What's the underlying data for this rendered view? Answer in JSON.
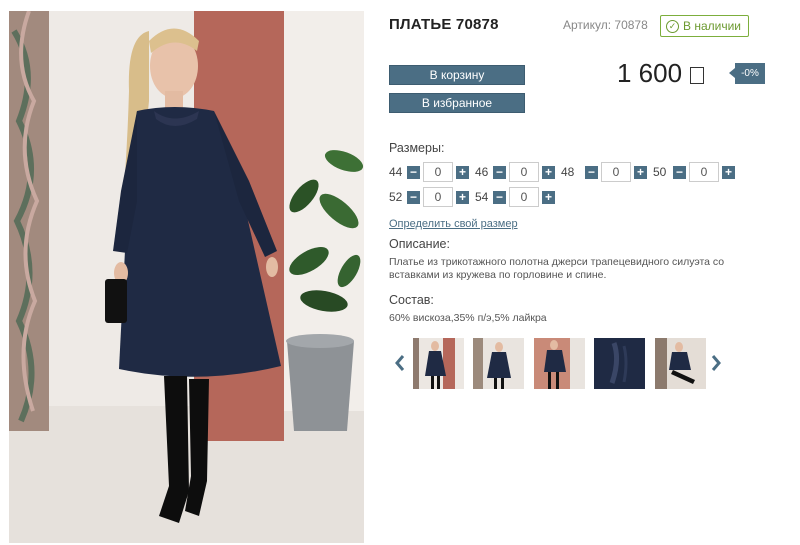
{
  "product": {
    "title": "ПЛАТЬЕ 70878",
    "sku": "Артикул: 70878",
    "stock": "В наличии",
    "add_to_cart": "В корзину",
    "add_to_favorites": "В избранное",
    "price": "1 600",
    "discount": "-0%"
  },
  "sizes": {
    "label": "Размеры:",
    "items": [
      {
        "size": "44",
        "qty": "0"
      },
      {
        "size": "46",
        "qty": "0"
      },
      {
        "size": "48",
        "qty": "0"
      },
      {
        "size": "50",
        "qty": "0"
      },
      {
        "size": "52",
        "qty": "0"
      },
      {
        "size": "54",
        "qty": "0"
      }
    ],
    "minus": "−",
    "plus": "+",
    "find_size_link": "Определить свой размер"
  },
  "description": {
    "label": "Описание:",
    "text": "Платье из трикотажного полотна  джерси трапецевидного силуэта со вставками из кружева по горловине и спине."
  },
  "composition": {
    "label": "Состав:",
    "text": "60% вискоза,35% п/э,5% лайкра"
  },
  "colors": {
    "accent": "#4b6e84",
    "stock_green": "#6c9a30",
    "dress": "#1f2a44"
  },
  "icons": {
    "stock": "check-circle-icon",
    "currency": "ruble-icon",
    "prev": "chevron-left-icon",
    "next": "chevron-right-icon"
  }
}
